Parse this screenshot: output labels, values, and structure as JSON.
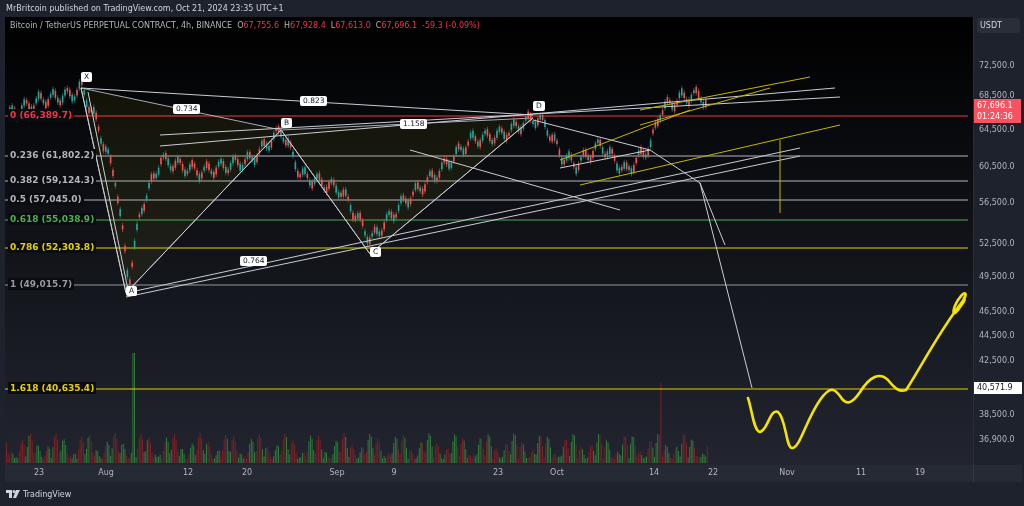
{
  "header": {
    "published": "MrBritcoin published on TradingView.com, Oct 21, 2024 23:35 UTC+1"
  },
  "legend": {
    "symbol": "Bitcoin / TetherUS PERPETUAL CONTRACT, 4h, BINANCE",
    "ohlc": [
      {
        "label": "O",
        "value": "67,755.6"
      },
      {
        "label": "H",
        "value": "67,928.4"
      },
      {
        "label": "L",
        "value": "67,613.0"
      },
      {
        "label": "C",
        "value": "67,696.1"
      }
    ],
    "change": "-59.3 (-0.09%)"
  },
  "fib_levels": [
    {
      "label": "0 (66,389.7)",
      "color": "#f23645"
    },
    {
      "label": "0.236 (61,802.2)",
      "color": "#b2b5be"
    },
    {
      "label": "0.382 (59,124.3)",
      "color": "#b2b5be"
    },
    {
      "label": "0.5 (57,045.0)",
      "color": "#b2b5be"
    },
    {
      "label": "0.618 (55,038.9)",
      "color": "#4caf50"
    },
    {
      "label": "0.786 (52,303.8)",
      "color": "#e6d200"
    },
    {
      "label": "1 (49,015.7)",
      "color": "#9598a1"
    },
    {
      "label": "1.618 (40,635.4)",
      "color": "#e6d200"
    }
  ],
  "pattern_points": [
    "X",
    "A",
    "B",
    "C",
    "D"
  ],
  "pattern_ratios": [
    "0.734",
    "0.823",
    "1.158",
    "0.764"
  ],
  "price_axis": {
    "currency": "USDT",
    "labels": [
      "72,500.0",
      "68,500.0",
      "64,500.0",
      "60,500.0",
      "56,500.0",
      "52,500.0",
      "49,500.0",
      "46,500.0",
      "44,500.0",
      "42,500.0",
      "38,500.0",
      "36,900.0"
    ],
    "last_price": "67,696.1",
    "countdown": "01:24:36",
    "marker": "40,571.9"
  },
  "time_axis": [
    "23",
    "Aug",
    "12",
    "20",
    "Sep",
    "9",
    "23",
    "Oct",
    "14",
    "22",
    "Nov",
    "11",
    "19"
  ],
  "footer": {
    "brand": "TradingView"
  }
}
